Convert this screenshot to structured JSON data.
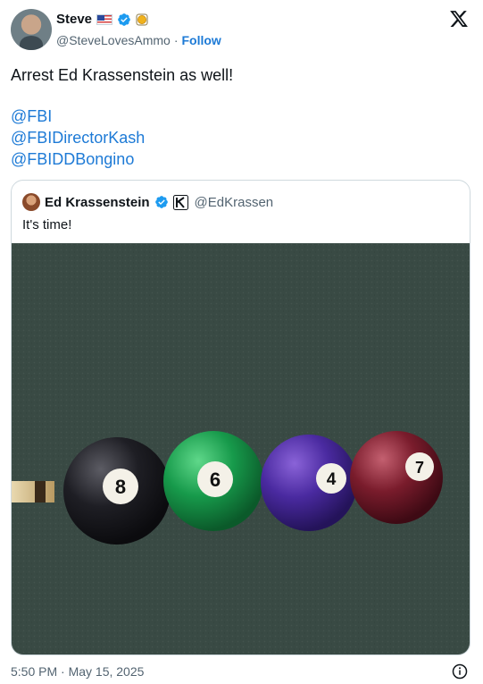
{
  "author": {
    "name": "Steve",
    "handle": "@SteveLovesAmmo",
    "separator": "·",
    "follow_label": "Follow"
  },
  "tweet": {
    "text": "Arrest Ed Krassenstein as well!",
    "mentions": [
      "@FBI",
      "@FBIDirectorKash",
      "@FBIDDBongino"
    ],
    "timestamp": "5:50 PM · May 15, 2025"
  },
  "quoted": {
    "name": "Ed Krassenstein",
    "handle": "@EdKrassen",
    "text": "It's time!",
    "photo": {
      "subject": "billiard balls on felt",
      "balls": [
        "8",
        "6",
        "4",
        "7"
      ]
    }
  },
  "icons": {
    "flag": "us-flag-icon",
    "verified": "verified-badge-icon",
    "affiliate": "gold-badge-icon",
    "logo": "x-logo-icon",
    "info": "info-icon"
  },
  "colors": {
    "link": "#1d7ad6",
    "verified": "#1d9bf0",
    "secondary_text": "#536471",
    "border": "#cfd9de",
    "felt": "#3a4a44"
  }
}
